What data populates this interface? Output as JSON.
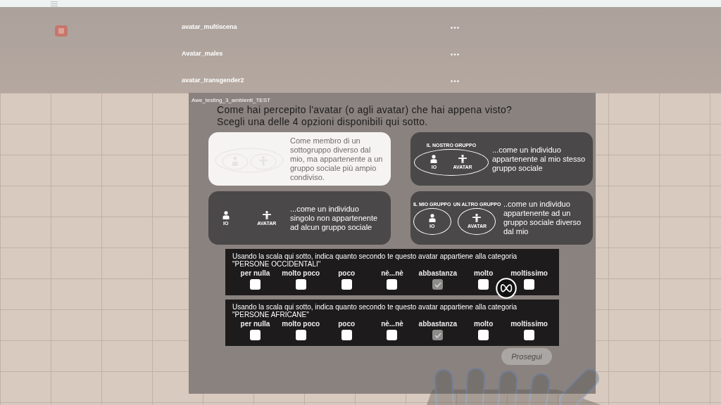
{
  "background_list": {
    "items": [
      {
        "title": "avatar_multiscena"
      },
      {
        "title": "Avatar_males"
      },
      {
        "title": "avatar_transgender2"
      }
    ]
  },
  "panel": {
    "title": "Awe_testing_3_ambienti_TEST",
    "question": [
      "Come hai percepito l'avatar (o agli avatar) che hai appena visto?",
      "Scegli una delle 4 opzioni disponibili qui sotto."
    ],
    "options": [
      {
        "kind": "nested",
        "selected": true,
        "text": "Come membro di un sottogruppo diverso dal mio, ma appartenente a un gruppo sociale più ampio condiviso."
      },
      {
        "kind": "shared",
        "selected": false,
        "text": "...come un individuo appartenente al mio stesso gruppo sociale",
        "group_label": "IL NOSTRO GRUPPO",
        "me_label": "IO",
        "avatar_label": "AVATAR"
      },
      {
        "kind": "single",
        "selected": false,
        "text": "...come un individuo singolo non appartenente ad alcun gruppo sociale",
        "me_label": "IO",
        "avatar_label": "AVATAR"
      },
      {
        "kind": "different",
        "selected": false,
        "text": "..come un individuo appartenente ad un gruppo sociale diverso dal mio",
        "my_group_label": "IL MIO GRUPPO",
        "other_group_label": "UN ALTRO GRUPPO",
        "me_label": "IO",
        "avatar_label": "AVATAR"
      }
    ],
    "scales": [
      {
        "prompt": "Usando la scala qui sotto, indica quanto secondo te questo avatar appartiene alla categoria",
        "category": "\"PERSONE OCCIDENTALI\"",
        "options": [
          {
            "label": "per nulla",
            "checked": false
          },
          {
            "label": "molto poco",
            "checked": false
          },
          {
            "label": "poco",
            "checked": false
          },
          {
            "label": "nè...nè",
            "checked": false
          },
          {
            "label": "abbastanza",
            "checked": true
          },
          {
            "label": "molto",
            "checked": false
          },
          {
            "label": "moltissimo",
            "checked": false
          }
        ]
      },
      {
        "prompt": "Usando la scala qui sotto, indica quanto secondo te questo avatar appartiene alla categoria",
        "category": "\"PERSONE AFRICANE\"",
        "options": [
          {
            "label": "per nulla",
            "checked": false
          },
          {
            "label": "molto poco",
            "checked": false
          },
          {
            "label": "poco",
            "checked": false
          },
          {
            "label": "nè...nè",
            "checked": false
          },
          {
            "label": "abbastanza",
            "checked": true
          },
          {
            "label": "molto",
            "checked": false
          },
          {
            "label": "moltissimo",
            "checked": false
          }
        ]
      }
    ],
    "continue_button": {
      "label": "Prosegui",
      "disabled": true
    }
  }
}
